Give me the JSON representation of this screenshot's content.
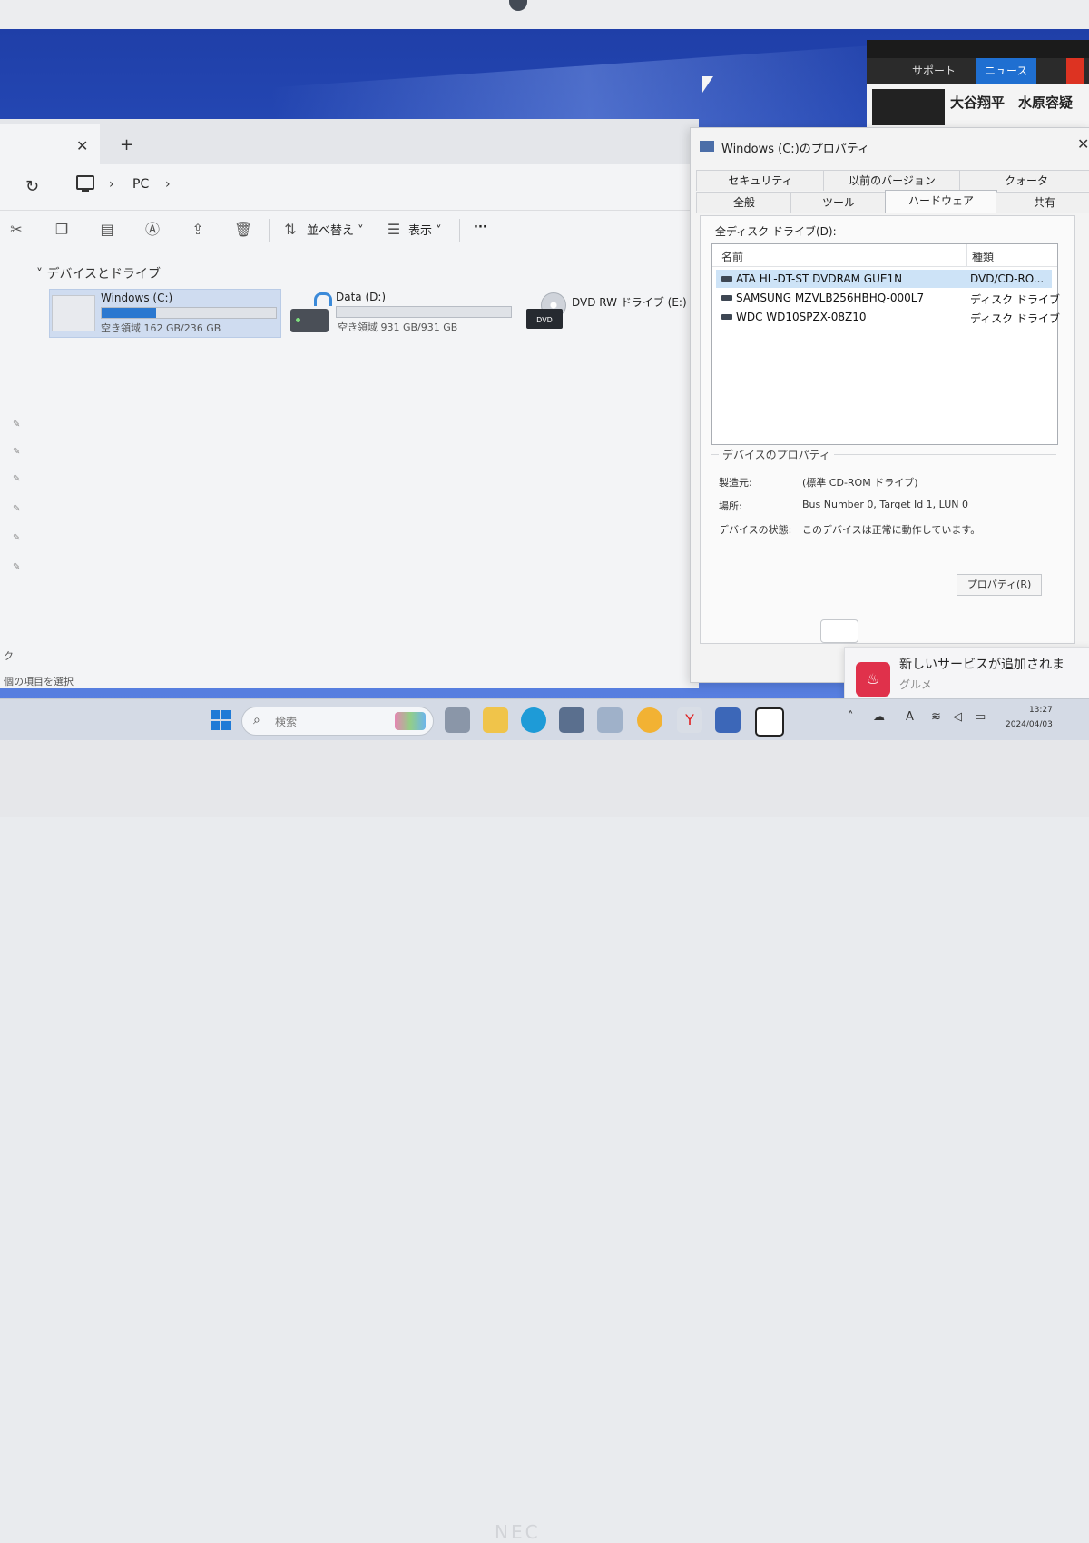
{
  "news": {
    "tab_support": "サポート",
    "tab_news": "ニュース",
    "headline": "大谷翔平　水原容疑"
  },
  "explorer": {
    "tab_close_glyph": "✕",
    "tab_new_glyph": "+",
    "address": {
      "location": "PC",
      "chevron": "›"
    },
    "toolbar": {
      "sort_label": "並べ替え",
      "view_label": "表示",
      "more_label": "···"
    },
    "section_title": "デバイスとドライブ",
    "drives": [
      {
        "name": "Windows (C:)",
        "free_text": "空き領域 162 GB/236 GB",
        "used_fraction": 0.31
      },
      {
        "name": "Data (D:)",
        "free_text": "空き領域 931 GB/931 GB",
        "used_fraction": 0.0
      },
      {
        "name": "DVD RW ドライブ (E:)",
        "icon_label": "DVD"
      }
    ],
    "status_left": "ク",
    "status_bottom": "個の項目を選択"
  },
  "properties": {
    "title": "Windows (C:)のプロパティ",
    "tabs_row1": [
      "セキュリティ",
      "以前のバージョン",
      "クォータ"
    ],
    "tabs_row2": [
      "全般",
      "ツール",
      "ハードウェア",
      "共有"
    ],
    "active_tab": "ハードウェア",
    "all_drives_label": "全ディスク ドライブ(D):",
    "columns": {
      "name": "名前",
      "type": "種類"
    },
    "devices": [
      {
        "name": "ATA HL-DT-ST DVDRAM GUE1N",
        "type": "DVD/CD-RO..."
      },
      {
        "name": "SAMSUNG MZVLB256HBHQ-000L7",
        "type": "ディスク ドライブ"
      },
      {
        "name": "WDC WD10SPZX-08Z10",
        "type": "ディスク ドライブ"
      }
    ],
    "device_props": {
      "legend": "デバイスのプロパティ",
      "manufacturer_label": "製造元:",
      "manufacturer_value": "(標準 CD-ROM ドライブ)",
      "location_label": "場所:",
      "location_value": "Bus Number 0, Target Id 1, LUN 0",
      "status_label": "デバイスの状態:",
      "status_value": "このデバイスは正常に動作しています。",
      "properties_button": "プロパティ(R)"
    }
  },
  "toast": {
    "title": "新しいサービスが追加されま",
    "subtitle": "グルメ"
  },
  "taskbar": {
    "search_placeholder": "検索",
    "clock_time": "13:27",
    "clock_date": "2024/04/03",
    "ime_indicator": "A"
  },
  "device": {
    "brand": "NEC"
  },
  "colors": {
    "accent": "#1f7ad6",
    "selection": "#cde3f7",
    "toast_icon": "#e0314b"
  }
}
